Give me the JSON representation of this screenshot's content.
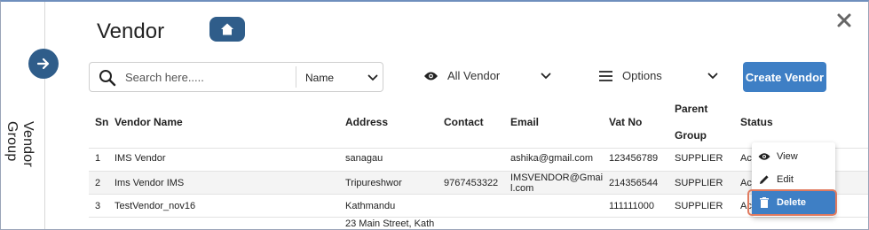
{
  "page": {
    "title": "Vendor"
  },
  "sidebar": {
    "label": "Vendor Group"
  },
  "search": {
    "placeholder": "Search here.....",
    "field": "Name"
  },
  "filters": {
    "vendor": "All Vendor",
    "options": "Options"
  },
  "actions": {
    "create_label": "Create Vendor"
  },
  "table": {
    "headers": {
      "sn": "Sn",
      "name": "Vendor Name",
      "address": "Address",
      "contact": "Contact",
      "email": "Email",
      "vat": "Vat No",
      "parent_1": "Parent",
      "parent_2": "Group",
      "status": "Status"
    },
    "rows": [
      {
        "sn": "1",
        "name": "IMS Vendor",
        "address": "sanagau",
        "contact": "",
        "email_1": "ashika@gmail.com",
        "email_2": "",
        "vat": "123456789",
        "parent": "SUPPLIER",
        "status": "Ac"
      },
      {
        "sn": "2",
        "name": "Ims Vendor IMS",
        "address": "Tripureshwor",
        "contact": "9767453322",
        "email_1": "IMSVENDOR@Gmai",
        "email_2": "l.com",
        "vat": "214356544",
        "parent": "SUPPLIER",
        "status": "Ac"
      },
      {
        "sn": "3",
        "name": "TestVendor_nov16",
        "address": "Kathmandu",
        "contact": "",
        "email_1": "",
        "email_2": "",
        "vat": "111111000",
        "parent": "SUPPLIER",
        "status": "Ac"
      },
      {
        "sn": "",
        "name": "",
        "address": "23 Main Street, Kath",
        "contact": "",
        "email_1": "",
        "email_2": "",
        "vat": "",
        "parent": "",
        "status": ""
      }
    ]
  },
  "row_menu": {
    "view": "View",
    "edit": "Edit",
    "delete": "Delete"
  },
  "colors": {
    "primary": "#2f5d8a",
    "accent": "#3e7fc5",
    "highlight": "#e07a5f"
  },
  "icons": [
    "arrow-right-icon",
    "home-icon",
    "close-icon",
    "search-icon",
    "chevron-down-icon",
    "eye-icon",
    "menu-icon",
    "pencil-icon",
    "trash-icon"
  ]
}
